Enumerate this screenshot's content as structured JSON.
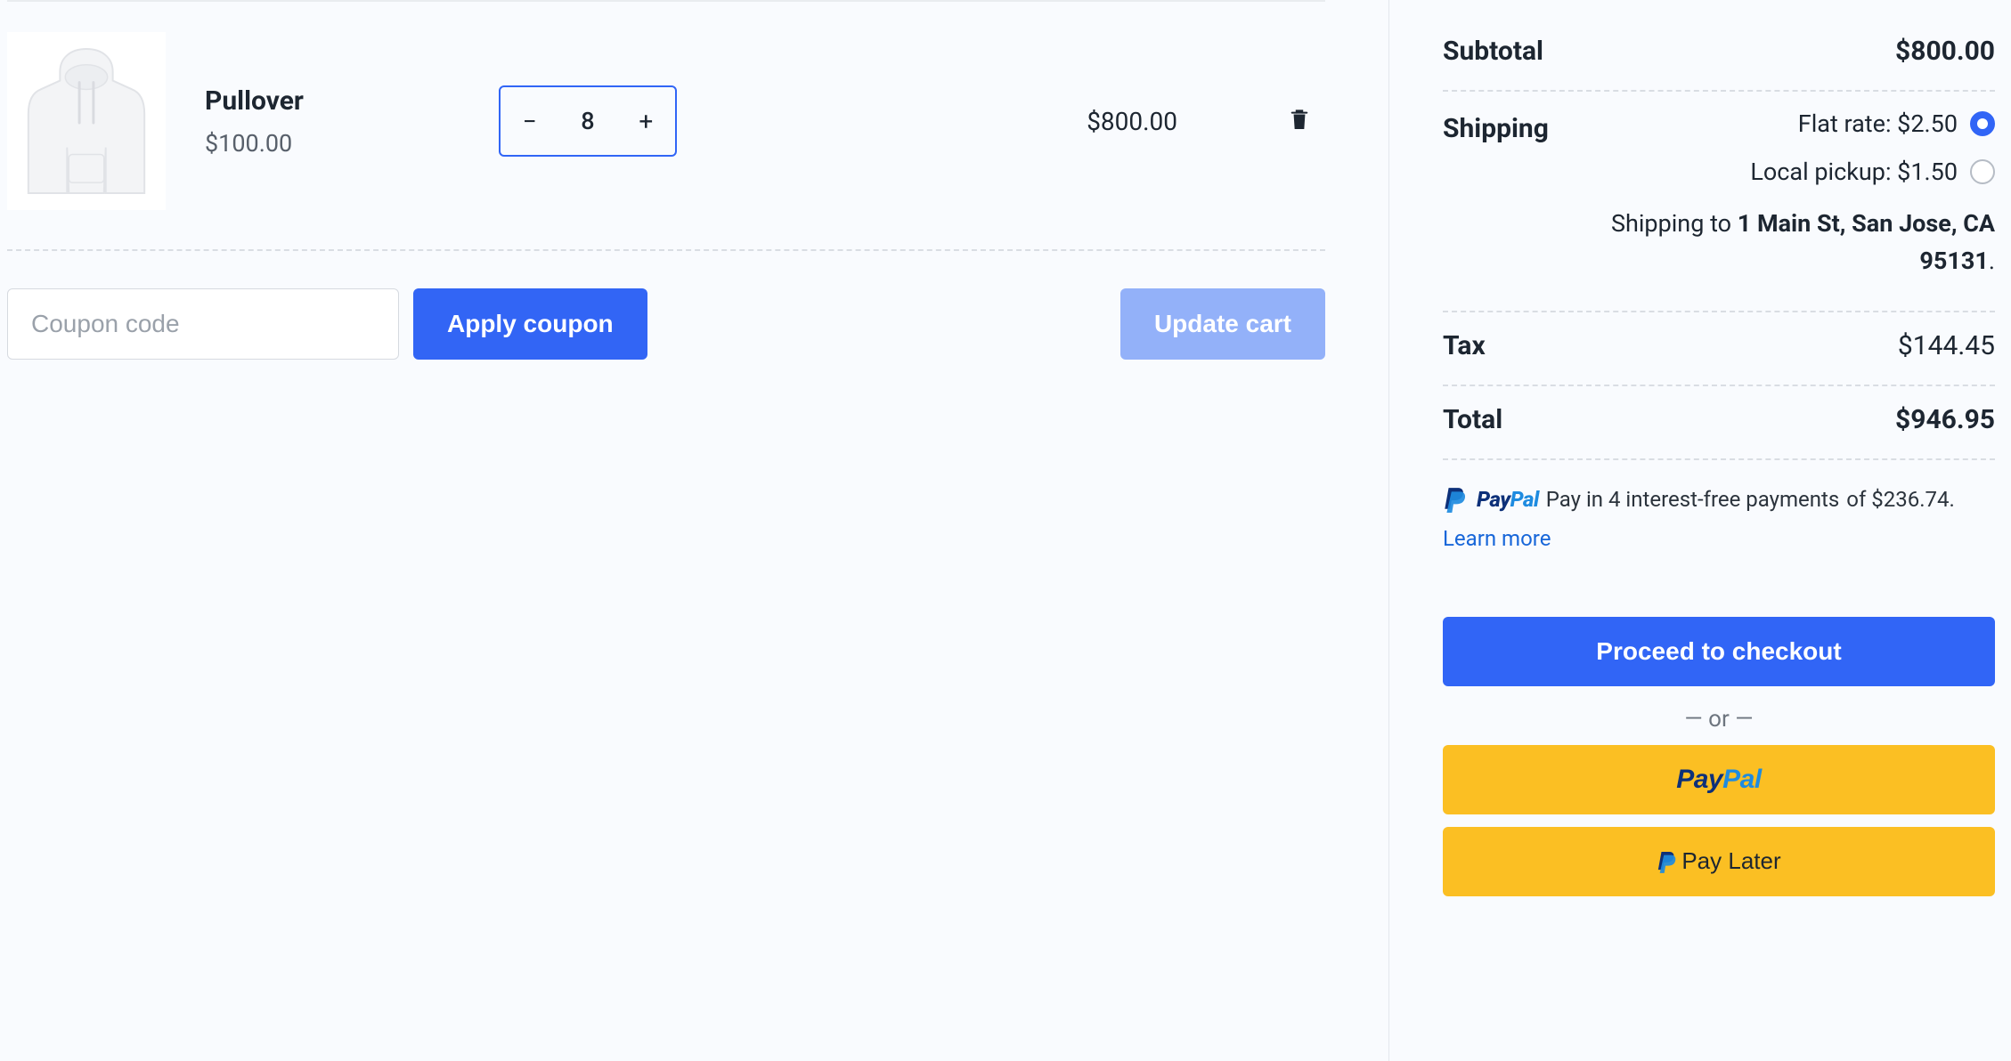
{
  "cart": {
    "item": {
      "name": "Pullover",
      "unit_price": "$100.00",
      "quantity": "8",
      "line_total": "$800.00"
    },
    "coupon_placeholder": "Coupon code",
    "apply_label": "Apply coupon",
    "update_label": "Update cart"
  },
  "summary": {
    "subtotal_label": "Subtotal",
    "subtotal_value": "$800.00",
    "shipping_label": "Shipping",
    "shipping_flat": "Flat rate: $2.50",
    "shipping_local": "Local pickup: $1.50",
    "shipping_to_prefix": "Shipping to ",
    "shipping_address": "1 Main St, San Jose, CA 95131",
    "tax_label": "Tax",
    "tax_value": "$144.45",
    "total_label": "Total",
    "total_value": "$946.95"
  },
  "paypal_msg": {
    "brand_dark": "Pay",
    "brand_blue": "Pal",
    "line1": "Pay in 4 interest-free payments",
    "line2_prefix": "of $236.74.",
    "learn": "Learn more"
  },
  "checkout": {
    "proceed": "Proceed to checkout",
    "or": "— or —",
    "paypal_dark": "Pay",
    "paypal_blue": "Pal",
    "paylater": "Pay Later"
  }
}
